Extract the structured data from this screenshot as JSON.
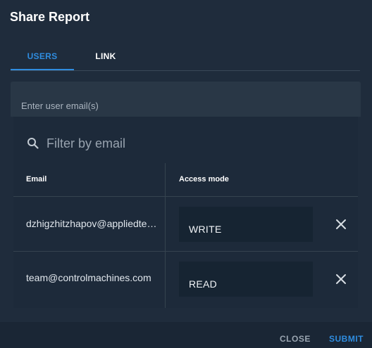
{
  "dialog": {
    "title": "Share Report"
  },
  "tabs": [
    {
      "label": "USERS",
      "active": true
    },
    {
      "label": "LINK",
      "active": false
    }
  ],
  "email_input": {
    "placeholder": "Enter user email(s)"
  },
  "filter": {
    "placeholder": "Filter by email",
    "icon": "search-icon"
  },
  "table": {
    "headers": {
      "email": "Email",
      "access": "Access mode"
    },
    "rows": [
      {
        "email": "dzhigzhitzhapov@appliedte…",
        "access": "WRITE"
      },
      {
        "email": "team@controlmachines.com",
        "access": "READ"
      }
    ]
  },
  "footer": {
    "close_label": "CLOSE",
    "submit_label": "SUBMIT"
  },
  "colors": {
    "accent": "#2f8de0",
    "background": "#1f2c3c"
  }
}
